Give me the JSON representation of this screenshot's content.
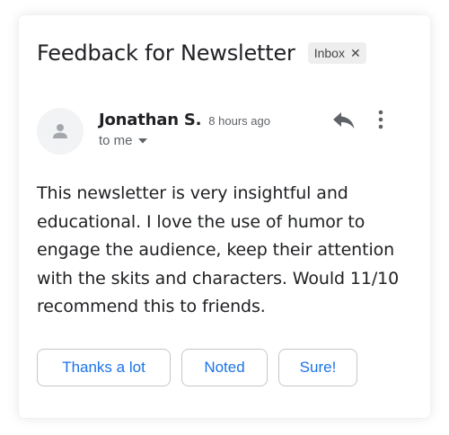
{
  "email": {
    "subject": "Feedback for Newsletter",
    "label": "Inbox",
    "sender_name": "Jonathan S.",
    "timestamp": "8 hours ago",
    "recipient": "to me",
    "body": "This newsletter is very insightful and educational. I love the use of humor to engage the audience, keep their attention with the skits and characters. Would 11/10 recommend this to friends."
  },
  "smart_replies": [
    {
      "label": "Thanks a lot"
    },
    {
      "label": "Noted"
    },
    {
      "label": "Sure!"
    }
  ],
  "icons": {
    "label_remove": "close-icon",
    "avatar": "person-icon",
    "recipient_details": "caret-down-icon",
    "reply": "reply-icon",
    "more": "more-vertical-icon"
  },
  "colors": {
    "accent": "#1a73e8",
    "text": "#202124",
    "muted": "#5f6368",
    "chip_background": "#eeeeee",
    "avatar_background": "#f1f3f4"
  }
}
